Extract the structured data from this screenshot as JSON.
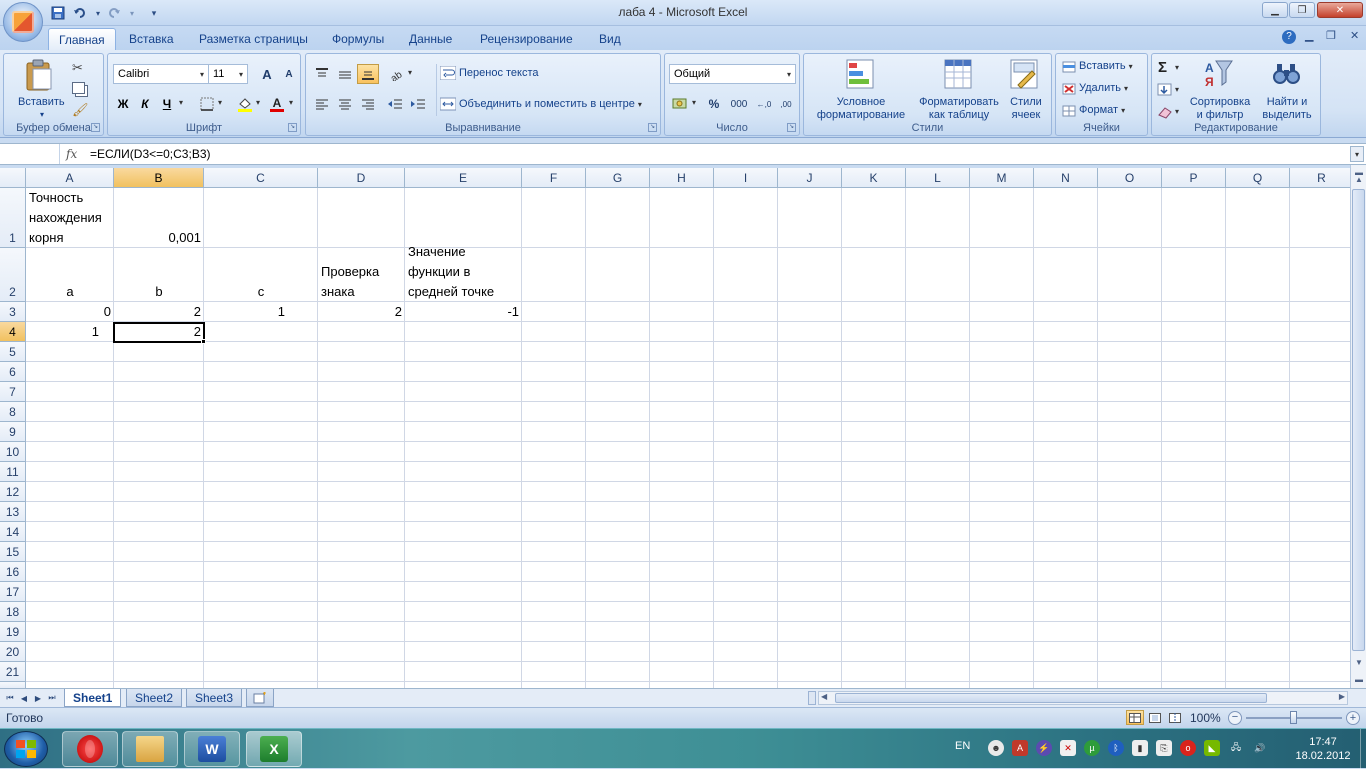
{
  "window": {
    "title": "лаба 4 - Microsoft Excel",
    "qat": {
      "save_icon": "save-icon",
      "undo_icon": "undo-icon",
      "redo_icon": "redo-icon"
    }
  },
  "ribbon_tabs": [
    "Главная",
    "Вставка",
    "Разметка страницы",
    "Формулы",
    "Данные",
    "Рецензирование",
    "Вид"
  ],
  "active_tab": "Главная",
  "ribbon": {
    "clipboard": {
      "label": "Буфер обмена",
      "paste": "Вставить"
    },
    "font": {
      "label": "Шрифт",
      "family": "Calibri",
      "size": "11",
      "bold": "Ж",
      "italic": "К",
      "underline": "Ч",
      "grow": "A",
      "shrink": "A",
      "fontcolor": "A"
    },
    "alignment": {
      "label": "Выравнивание",
      "wrap": "Перенос текста",
      "merge": "Объединить и поместить в центре"
    },
    "number": {
      "label": "Число",
      "format": "Общий",
      "percent": "%",
      "thousands": "000",
      "inc": "←,0",
      "dec": ",00"
    },
    "styles": {
      "label": "Стили",
      "conditional": [
        "Условное",
        "форматирование"
      ],
      "table": [
        "Форматировать",
        "как таблицу"
      ],
      "cell_styles": [
        "Стили",
        "ячеек"
      ]
    },
    "cells": {
      "label": "Ячейки",
      "insert": "Вставить",
      "delete": "Удалить",
      "format": "Формат"
    },
    "editing": {
      "label": "Редактирование",
      "sort": [
        "Сортировка",
        "и фильтр"
      ],
      "find": [
        "Найти и",
        "выделить"
      ],
      "sigma": "Σ"
    }
  },
  "formula_bar": {
    "name_box": "",
    "fx": "fx",
    "formula": "=ЕСЛИ(D3<=0;C3;B3)"
  },
  "columns": [
    "A",
    "B",
    "C",
    "D",
    "E",
    "F",
    "G",
    "H",
    "I",
    "J",
    "K",
    "L",
    "M",
    "N",
    "O",
    "P",
    "Q",
    "R"
  ],
  "selected_column": "B",
  "selected_row": "4",
  "rows": [
    "1",
    "2",
    "3",
    "4",
    "5",
    "6",
    "7",
    "8",
    "9",
    "10",
    "11",
    "12",
    "13",
    "14",
    "15",
    "16",
    "17",
    "18",
    "19",
    "20",
    "21"
  ],
  "cells": {
    "A1": [
      "Точность",
      "нахождения",
      "корня"
    ],
    "B1": "0,001",
    "A2": "a",
    "B2": "b",
    "C2": "c",
    "D2": [
      "Проверка",
      "знака"
    ],
    "E2": [
      "Значение",
      "функции в",
      "средней точке"
    ],
    "A3": "0",
    "B3": "2",
    "C3": "1",
    "D3": "2",
    "E3": "-1",
    "A4": "1",
    "B4": "2"
  },
  "sheet_tabs": [
    "Sheet1",
    "Sheet2",
    "Sheet3"
  ],
  "active_sheet": "Sheet1",
  "status": {
    "text": "Готово",
    "zoom": "100%"
  },
  "taskbar": {
    "lang": "EN",
    "time": "17:47",
    "date": "18.02.2012",
    "apps": [
      "opera-icon",
      "explorer-icon",
      "word-icon",
      "excel-icon"
    ]
  }
}
